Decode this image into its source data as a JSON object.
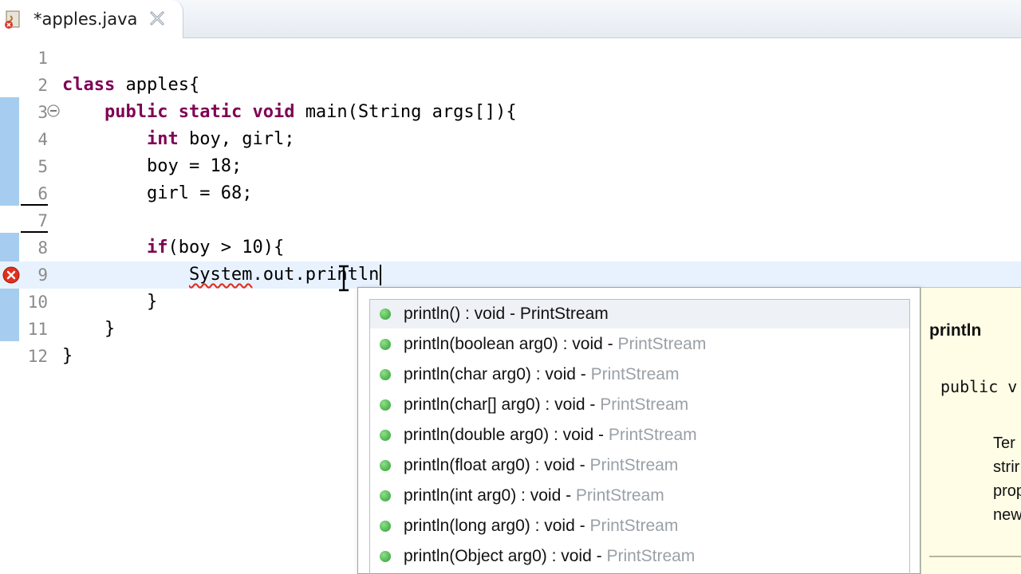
{
  "tab": {
    "title": "*apples.java",
    "icon": "java-file-error-icon",
    "close_icon": "close-icon"
  },
  "editor": {
    "lines": [
      {
        "number": "1",
        "code": ""
      },
      {
        "number": "2",
        "code": "class apples{"
      },
      {
        "number": "3",
        "code": "    public static void main(String args[]){"
      },
      {
        "number": "4",
        "code": "        int boy, girl;"
      },
      {
        "number": "5",
        "code": "        boy = 18;"
      },
      {
        "number": "6",
        "code": "        girl = 68;"
      },
      {
        "number": "7",
        "code": ""
      },
      {
        "number": "8",
        "code": "        if(boy > 10){"
      },
      {
        "number": "9",
        "code": "            System.out.println"
      },
      {
        "number": "10",
        "code": "        }"
      },
      {
        "number": "11",
        "code": "    }"
      },
      {
        "number": "12",
        "code": "}"
      }
    ],
    "keywords": [
      "class",
      "public",
      "static",
      "void",
      "int",
      "if"
    ],
    "error_line": "9",
    "current_line": "9",
    "colors": {
      "keyword": "#7f0055",
      "gutter_change": "#a6cdef",
      "error": "#e0301e"
    }
  },
  "completion": {
    "items": [
      {
        "signature": "println() : void",
        "class": "PrintStream"
      },
      {
        "signature": "println(boolean arg0) : void",
        "class": "PrintStream"
      },
      {
        "signature": "println(char arg0) : void",
        "class": "PrintStream"
      },
      {
        "signature": "println(char[] arg0) : void",
        "class": "PrintStream"
      },
      {
        "signature": "println(double arg0) : void",
        "class": "PrintStream"
      },
      {
        "signature": "println(float arg0) : void",
        "class": "PrintStream"
      },
      {
        "signature": "println(int arg0) : void",
        "class": "PrintStream"
      },
      {
        "signature": "println(long arg0) : void",
        "class": "PrintStream"
      },
      {
        "signature": "println(Object arg0) : void",
        "class": "PrintStream"
      }
    ],
    "selected_index": 0,
    "item_icon": "public-method-icon"
  },
  "javadoc": {
    "title": "println",
    "signature": "public v",
    "text_lines": [
      "Ter",
      "strir",
      "prop",
      "new"
    ]
  }
}
